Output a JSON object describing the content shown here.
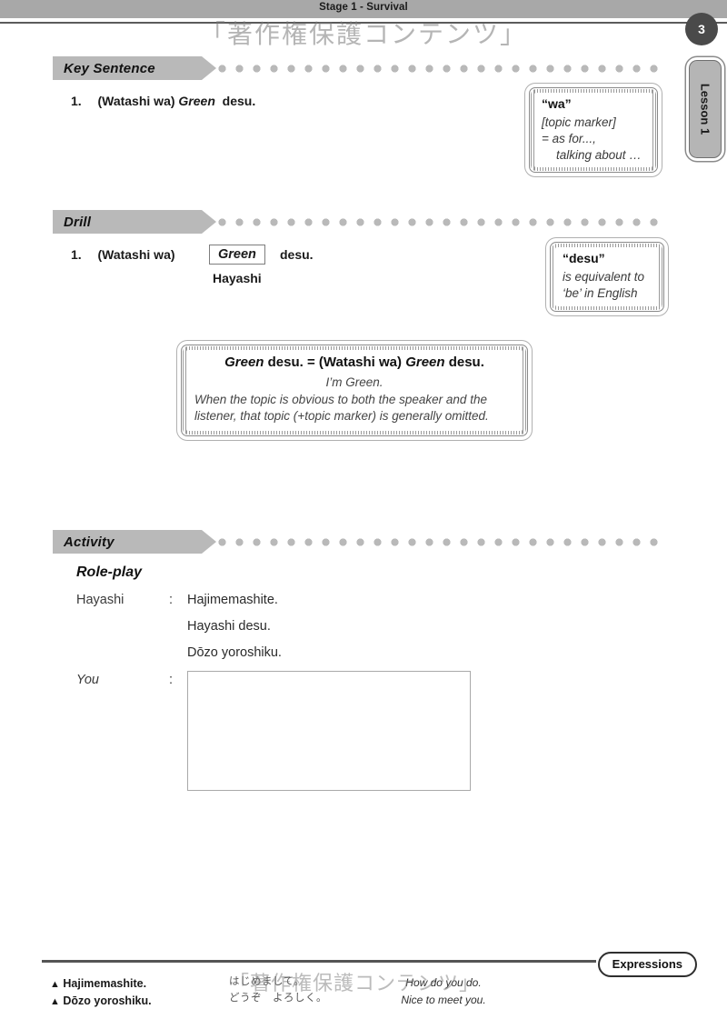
{
  "header": {
    "stage_title": "Stage 1 - Survival",
    "page_number": "3",
    "lesson_tab": "Lesson 1",
    "watermark": "「著作権保護コンテンツ」"
  },
  "sections": {
    "key_sentence": {
      "banner_label": "Key Sentence",
      "items": [
        {
          "number": "1.",
          "prefix": "(Watashi wa)",
          "italic": "Green",
          "suffix": "desu."
        }
      ]
    },
    "drill": {
      "banner_label": "Drill",
      "items": [
        {
          "number": "1.",
          "prefix": "(Watashi wa)",
          "boxed": "Green",
          "suffix": "desu.",
          "alternate": "Hayashi"
        }
      ]
    },
    "activity": {
      "banner_label": "Activity",
      "roleplay_title": "Role-play",
      "dialogue": [
        {
          "speaker": "Hayashi",
          "colon": ":",
          "lines": [
            "Hajimemashite.",
            "Hayashi desu.",
            "Dōzo yoroshiku."
          ]
        },
        {
          "speaker": "You",
          "colon": ":",
          "lines": [],
          "answer_box_empty": true
        }
      ]
    }
  },
  "notes": [
    {
      "id": "wa-note",
      "title": "“wa”",
      "lines": [
        "[topic marker]",
        "= as for...,",
        "talking about …"
      ]
    },
    {
      "id": "desu-note",
      "title": "“desu”",
      "lines": [
        "is equivalent to",
        "‘be’ in English"
      ]
    }
  ],
  "explanation": {
    "equation_part1": "Green",
    "equation_part2": " desu. = (Watashi wa) ",
    "equation_part3": "Green",
    "equation_part4": " desu.",
    "translation": "I’m Green.",
    "body_line1": "When the topic is obvious to both the speaker and the",
    "body_line2": "listener, that topic (+topic marker) is generally omitted."
  },
  "footer": {
    "tab_label": "Expressions",
    "entries": [
      {
        "marker": "▲",
        "romaji": "Hajimemashite.",
        "kana": "はじめまして。",
        "english": "How do you do."
      },
      {
        "marker": "▲",
        "romaji": "Dōzo yoroshiku.",
        "kana": "どうぞ　よろしく。",
        "english": "Nice to meet you."
      }
    ],
    "watermark": "「著作権保護コンテンツ」"
  },
  "colors": {
    "banner_gray": "#b9b9b9",
    "header_band": "#a8a8a8",
    "page_bubble": "#4a4a4a",
    "tab_gray": "#b5b5b5"
  }
}
